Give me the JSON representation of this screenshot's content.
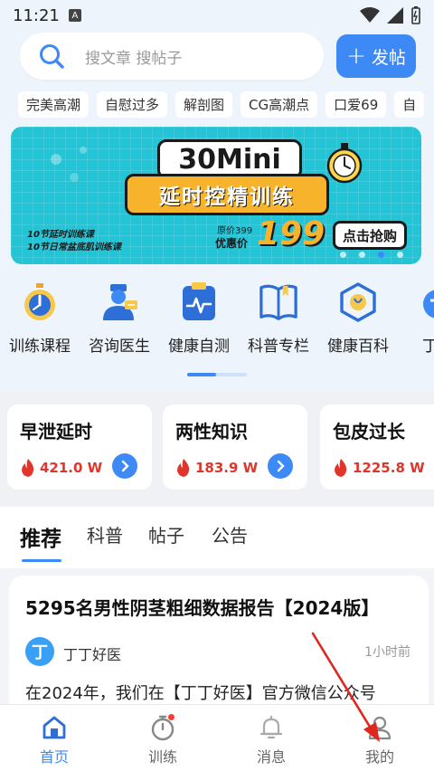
{
  "status": {
    "time": "11:21",
    "sim": "A"
  },
  "search": {
    "placeholder": "搜文章 搜帖子"
  },
  "post_button": {
    "label": "发帖"
  },
  "tags": [
    "完美高潮",
    "自慰过多",
    "解剖图",
    "CG高潮点",
    "口爱69",
    "自"
  ],
  "banner": {
    "title1": "30Mini",
    "title2": "延时控精训练",
    "line1": "10节延时训练课",
    "line2": "10节日常盆底肌训练课",
    "original_price": "原价399",
    "deal_label": "优惠价",
    "price": "199",
    "buy_label": "点击抢购",
    "slide_count": 4,
    "active_slide": 3
  },
  "quick_items": [
    {
      "icon": "stopwatch-icon",
      "label": "训练课程"
    },
    {
      "icon": "doctor-icon",
      "label": "咨询医生"
    },
    {
      "icon": "heart-monitor-icon",
      "label": "健康自测"
    },
    {
      "icon": "book-icon",
      "label": "科普专栏"
    },
    {
      "icon": "encyclopedia-icon",
      "label": "健康百科"
    },
    {
      "icon": "dingding-icon",
      "label": "丁丁"
    }
  ],
  "topic_cards": [
    {
      "title": "早泄延时",
      "heat": "421.0 W"
    },
    {
      "title": "两性知识",
      "heat": "183.9 W"
    },
    {
      "title": "包皮过长",
      "heat": "1225.8 W"
    }
  ],
  "tabs": [
    "推荐",
    "科普",
    "帖子",
    "公告"
  ],
  "article": {
    "title": "5295名男性阴茎粗细数据报告【2024版】",
    "avatar_char": "丁",
    "author": "丁丁好医",
    "time": "1小时前",
    "excerpt": "在2024年，我们在【丁丁好医】官方微信公众号"
  },
  "bottom_nav": [
    {
      "icon": "home-icon",
      "label": "首页",
      "active": true
    },
    {
      "icon": "stopwatch-icon",
      "label": "训练",
      "badge": true
    },
    {
      "icon": "bell-icon",
      "label": "消息"
    },
    {
      "icon": "profile-icon",
      "label": "我的"
    }
  ],
  "colors": {
    "accent": "#3d8af7",
    "banner": "#22c4d6",
    "hot": "#e0352b"
  }
}
